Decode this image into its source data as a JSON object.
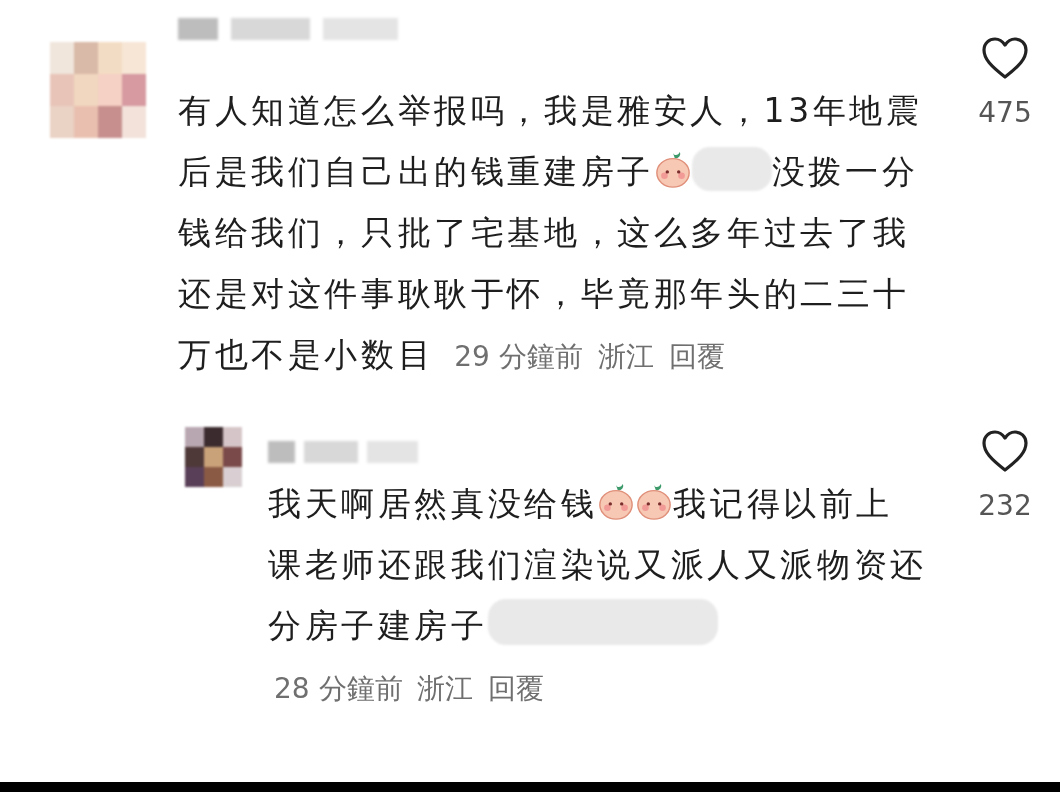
{
  "comments": [
    {
      "segments": [
        {
          "kind": "text",
          "text": "有人知道怎么举报吗，我是雅安人，13年地震后是我们自己出的钱重建房子"
        },
        {
          "kind": "emoji"
        },
        {
          "kind": "blot"
        },
        {
          "kind": "text",
          "text": "没拨一分钱给我们，只批了宅基地，这么多年过去了我还是对这件事耿耿于怀，毕竟那年头的二三十万也不是小数目"
        }
      ],
      "meta": {
        "time": "29 分鐘前",
        "location": "浙江",
        "reply": "回覆"
      },
      "likes": "475",
      "replies": [
        {
          "segments": [
            {
              "kind": "text",
              "text": "我天啊居然真没给钱"
            },
            {
              "kind": "emoji"
            },
            {
              "kind": "emoji"
            },
            {
              "kind": "text",
              "text": "我记得以前上课老师还跟我们渲染说又派人又派物资还分房子建房子"
            },
            {
              "kind": "blot"
            }
          ],
          "meta": {
            "time": "28 分鐘前",
            "location": "浙江",
            "reply": "回覆"
          },
          "likes": "232"
        }
      ]
    }
  ]
}
